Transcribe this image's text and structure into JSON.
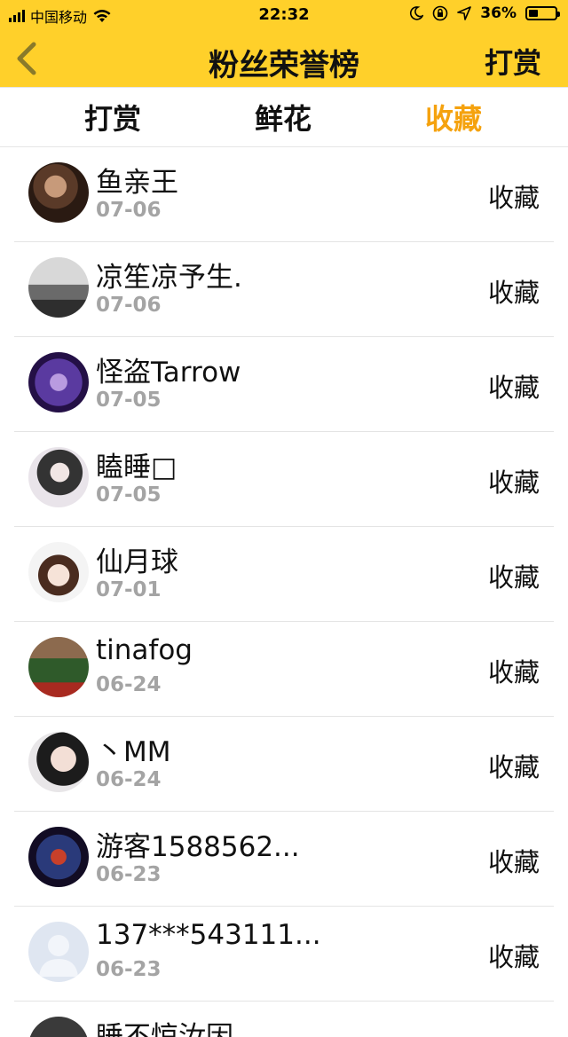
{
  "status_bar": {
    "carrier": "中国移动",
    "time": "22:32",
    "battery_text": "36%",
    "battery_level": 0.36
  },
  "nav": {
    "title": "粉丝荣誉榜",
    "right_button": "打赏",
    "back_icon": "chevron-left-icon"
  },
  "tabs": [
    {
      "label": "打赏",
      "active": false
    },
    {
      "label": "鲜花",
      "active": false
    },
    {
      "label": "收藏",
      "active": true
    }
  ],
  "colors": {
    "header_bg": "#ffd02a",
    "active_tab": "#f5a20e",
    "date_gray": "#a4a4a4"
  },
  "fans": [
    {
      "name": "鱼亲王",
      "date": "07-06",
      "action": "收藏"
    },
    {
      "name": "凉笙凉予生.",
      "date": "07-06",
      "action": "收藏"
    },
    {
      "name": "怪盗Tarrow",
      "date": "07-05",
      "action": "收藏"
    },
    {
      "name": "瞌睡□",
      "date": "07-05",
      "action": "收藏"
    },
    {
      "name": "仙月球",
      "date": "07-01",
      "action": "收藏"
    },
    {
      "name": "tinafog",
      "date": "06-24",
      "action": "收藏"
    },
    {
      "name": "丶MM",
      "date": "06-24",
      "action": "收藏"
    },
    {
      "name": "游客1588562...",
      "date": "06-23",
      "action": "收藏"
    },
    {
      "name": "137***543111...",
      "date": "06-23",
      "action": "收藏"
    },
    {
      "name": "睡不惊汝因",
      "date": "",
      "action": ""
    }
  ]
}
